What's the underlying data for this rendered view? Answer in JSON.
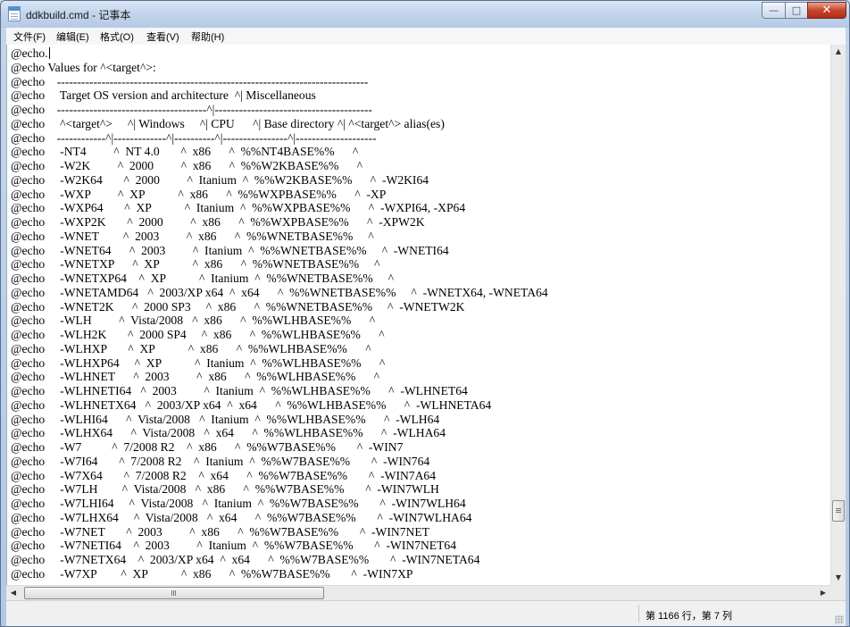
{
  "window": {
    "title": "ddkbuild.cmd - 记事本",
    "icon": "notepad-icon"
  },
  "titlebar_buttons": {
    "minimize": "—",
    "maximize": "□",
    "close": "✕"
  },
  "menu": {
    "file": "文件(F)",
    "edit": "编辑(E)",
    "format": "格式(O)",
    "view": "查看(V)",
    "help": "帮助(H)"
  },
  "editor": {
    "content": "@echo.\n@echo Values for ^<target^>:\n@echo    -----------------------------------------------------------------------------\n@echo     Target OS version and architecture  ^| Miscellaneous\n@echo    -------------------------------------^|---------------------------------------\n@echo     ^<target^>     ^| Windows     ^| CPU      ^| Base directory ^| ^<target^> alias(es)\n@echo    ------------^|-------------^|----------^|----------------^|--------------------\n@echo     -NT4         ^  NT 4.0       ^  x86      ^  %%NT4BASE%%      ^\n@echo     -W2K         ^  2000         ^  x86      ^  %%W2KBASE%%      ^\n@echo     -W2K64       ^  2000         ^  Itanium  ^  %%W2KBASE%%      ^  -W2KI64\n@echo     -WXP         ^  XP           ^  x86      ^  %%WXPBASE%%      ^  -XP\n@echo     -WXP64       ^  XP           ^  Itanium  ^  %%WXPBASE%%      ^  -WXPI64, -XP64\n@echo     -WXP2K       ^  2000         ^  x86      ^  %%WXPBASE%%      ^  -XPW2K\n@echo     -WNET        ^  2003         ^  x86      ^  %%WNETBASE%%     ^\n@echo     -WNET64      ^  2003         ^  Itanium  ^  %%WNETBASE%%     ^  -WNETI64\n@echo     -WNETXP      ^  XP           ^  x86      ^  %%WNETBASE%%     ^\n@echo     -WNETXP64    ^  XP           ^  Itanium  ^  %%WNETBASE%%     ^\n@echo     -WNETAMD64   ^  2003/XP x64  ^  x64      ^  %%WNETBASE%%     ^  -WNETX64, -WNETA64\n@echo     -WNET2K      ^  2000 SP3     ^  x86      ^  %%WNETBASE%%     ^  -WNETW2K\n@echo     -WLH         ^  Vista/2008   ^  x86      ^  %%WLHBASE%%      ^\n@echo     -WLH2K       ^  2000 SP4     ^  x86      ^  %%WLHBASE%%      ^\n@echo     -WLHXP       ^  XP           ^  x86      ^  %%WLHBASE%%      ^\n@echo     -WLHXP64     ^  XP           ^  Itanium  ^  %%WLHBASE%%      ^\n@echo     -WLHNET      ^  2003         ^  x86      ^  %%WLHBASE%%      ^\n@echo     -WLHNETI64   ^  2003         ^  Itanium  ^  %%WLHBASE%%      ^  -WLHNET64\n@echo     -WLHNETX64   ^  2003/XP x64  ^  x64      ^  %%WLHBASE%%      ^  -WLHNETA64\n@echo     -WLHI64      ^  Vista/2008   ^  Itanium  ^  %%WLHBASE%%      ^  -WLH64\n@echo     -WLHX64      ^  Vista/2008   ^  x64      ^  %%WLHBASE%%      ^  -WLHA64\n@echo     -W7          ^  7/2008 R2    ^  x86      ^  %%W7BASE%%       ^  -WIN7\n@echo     -W7I64       ^  7/2008 R2    ^  Itanium  ^  %%W7BASE%%       ^  -WIN764\n@echo     -W7X64       ^  7/2008 R2    ^  x64      ^  %%W7BASE%%       ^  -WIN7A64\n@echo     -W7LH        ^  Vista/2008   ^  x86      ^  %%W7BASE%%       ^  -WIN7WLH\n@echo     -W7LHI64     ^  Vista/2008   ^  Itanium  ^  %%W7BASE%%       ^  -WIN7WLH64\n@echo     -W7LHX64     ^  Vista/2008   ^  x64      ^  %%W7BASE%%       ^  -WIN7WLHA64\n@echo     -W7NET       ^  2003         ^  x86      ^  %%W7BASE%%       ^  -WIN7NET\n@echo     -W7NETI64    ^  2003         ^  Itanium  ^  %%W7BASE%%       ^  -WIN7NET64\n@echo     -W7NETX64    ^  2003/XP x64  ^  x64      ^  %%W7BASE%%       ^  -WIN7NETA64\n@echo     -W7XP        ^  XP           ^  x86      ^  %%W7BASE%%       ^  -WIN7XP"
  },
  "scrollbars": {
    "up_arrow": "▲",
    "down_arrow": "▼",
    "left_arrow": "◀",
    "right_arrow": "▶",
    "vertical_position": 0.9,
    "horizontal_position": 0.0
  },
  "status": {
    "position": "第 1166 行，第 7 列"
  }
}
